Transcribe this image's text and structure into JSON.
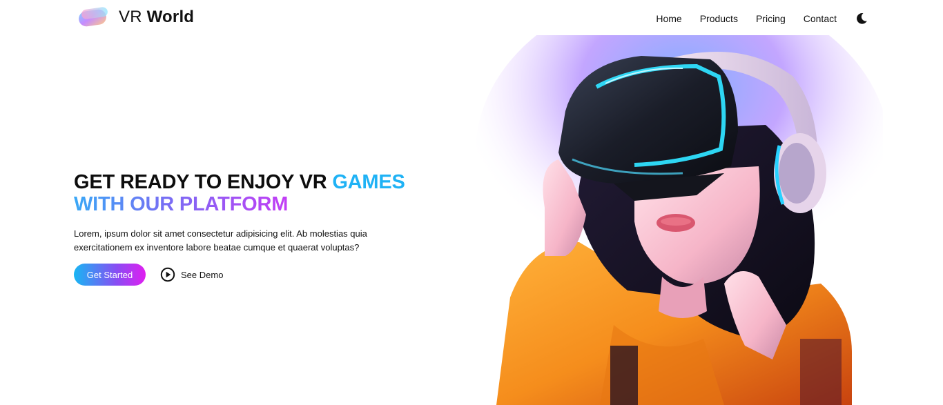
{
  "brand": {
    "name_light": "VR",
    "name_bold": "World"
  },
  "nav": {
    "items": [
      {
        "label": "Home"
      },
      {
        "label": "Products"
      },
      {
        "label": "Pricing"
      },
      {
        "label": "Contact"
      }
    ],
    "theme_toggle_icon": "moon-icon"
  },
  "hero": {
    "title_line1_dark": "GET READY TO ENJOY VR",
    "title_line1_accent": "GAMES",
    "title_line2": "WITH OUR PLATFORM",
    "description": "Lorem, ipsum dolor sit amet consectetur adipisicing elit. Ab molestias quia exercitationem ex inventore labore beatae cumque et quaerat voluptas?",
    "primary_button": "Get Started",
    "secondary_button": "See Demo",
    "secondary_icon": "play-circle-icon"
  },
  "colors": {
    "accent_blue": "#1fb2f5",
    "accent_purple": "#c33df5",
    "text": "#111111"
  }
}
